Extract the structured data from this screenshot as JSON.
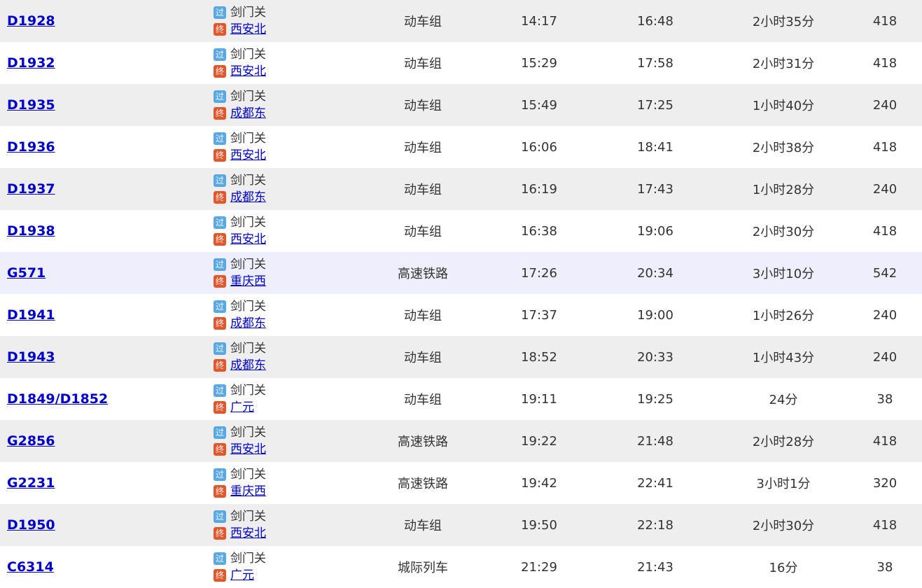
{
  "icons": {
    "pass_badge": "过",
    "end_badge": "终"
  },
  "rows": [
    {
      "train": "D1928",
      "pass_station": "剑门关",
      "end_station": "西安北",
      "type": "动车组",
      "depart": "14:17",
      "arrive": "16:48",
      "duration": "2小时35分",
      "price": "418"
    },
    {
      "train": "D1932",
      "pass_station": "剑门关",
      "end_station": "西安北",
      "type": "动车组",
      "depart": "15:29",
      "arrive": "17:58",
      "duration": "2小时31分",
      "price": "418"
    },
    {
      "train": "D1935",
      "pass_station": "剑门关",
      "end_station": "成都东",
      "type": "动车组",
      "depart": "15:49",
      "arrive": "17:25",
      "duration": "1小时40分",
      "price": "240"
    },
    {
      "train": "D1936",
      "pass_station": "剑门关",
      "end_station": "西安北",
      "type": "动车组",
      "depart": "16:06",
      "arrive": "18:41",
      "duration": "2小时38分",
      "price": "418"
    },
    {
      "train": "D1937",
      "pass_station": "剑门关",
      "end_station": "成都东",
      "type": "动车组",
      "depart": "16:19",
      "arrive": "17:43",
      "duration": "1小时28分",
      "price": "240"
    },
    {
      "train": "D1938",
      "pass_station": "剑门关",
      "end_station": "西安北",
      "type": "动车组",
      "depart": "16:38",
      "arrive": "19:06",
      "duration": "2小时30分",
      "price": "418"
    },
    {
      "train": "G571",
      "pass_station": "剑门关",
      "end_station": "重庆西",
      "type": "高速铁路",
      "depart": "17:26",
      "arrive": "20:34",
      "duration": "3小时10分",
      "price": "542"
    },
    {
      "train": "D1941",
      "pass_station": "剑门关",
      "end_station": "成都东",
      "type": "动车组",
      "depart": "17:37",
      "arrive": "19:00",
      "duration": "1小时26分",
      "price": "240"
    },
    {
      "train": "D1943",
      "pass_station": "剑门关",
      "end_station": "成都东",
      "type": "动车组",
      "depart": "18:52",
      "arrive": "20:33",
      "duration": "1小时43分",
      "price": "240"
    },
    {
      "train": "D1849/D1852",
      "pass_station": "剑门关",
      "end_station": "广元",
      "type": "动车组",
      "depart": "19:11",
      "arrive": "19:25",
      "duration": "24分",
      "price": "38"
    },
    {
      "train": "G2856",
      "pass_station": "剑门关",
      "end_station": "西安北",
      "type": "高速铁路",
      "depart": "19:22",
      "arrive": "21:48",
      "duration": "2小时28分",
      "price": "418"
    },
    {
      "train": "G2231",
      "pass_station": "剑门关",
      "end_station": "重庆西",
      "type": "高速铁路",
      "depart": "19:42",
      "arrive": "22:41",
      "duration": "3小时1分",
      "price": "320"
    },
    {
      "train": "D1950",
      "pass_station": "剑门关",
      "end_station": "西安北",
      "type": "动车组",
      "depart": "19:50",
      "arrive": "22:18",
      "duration": "2小时30分",
      "price": "418"
    },
    {
      "train": "C6314",
      "pass_station": "剑门关",
      "end_station": "广元",
      "type": "城际列车",
      "depart": "21:29",
      "arrive": "21:43",
      "duration": "16分",
      "price": "38"
    }
  ]
}
